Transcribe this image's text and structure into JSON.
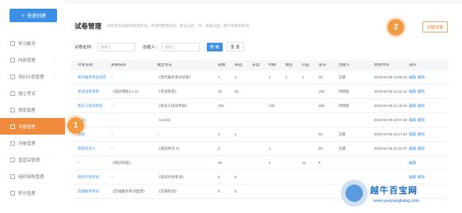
{
  "sidebar": {
    "quick_label": "快速创建",
    "items": [
      {
        "label": "学习概况",
        "caret": ""
      },
      {
        "label": "内容管理",
        "caret": "›"
      },
      {
        "label": "培训计划管理",
        "caret": "›"
      },
      {
        "label": "独立考试",
        "caret": ""
      },
      {
        "label": "题库管理",
        "caret": ""
      },
      {
        "label": "试卷管理",
        "caret": ""
      },
      {
        "label": "问卷管理",
        "caret": ""
      },
      {
        "label": "直营店管理",
        "caret": "›"
      },
      {
        "label": "组织架构管理",
        "caret": ""
      },
      {
        "label": "积分管理",
        "caret": ""
      }
    ]
  },
  "header": {
    "title": "试卷管理",
    "subtitle": "试卷包含试题的组合形式，考试时使用试卷，建议以初、中、高级分类，便于组卷和考试",
    "create_button": "创建试卷"
  },
  "filters": {
    "name_label": "试卷名称：",
    "name_placeholder": "请输入",
    "creator_label": "创建人：",
    "creator_placeholder": "请输入",
    "search_button": "搜 索",
    "reset_button": "重 置"
  },
  "table": {
    "headers": [
      "考卷名称",
      "关联培训",
      "独立考试",
      "题数",
      "单选",
      "多选",
      "判断",
      "填空",
      "问答",
      "总分",
      "创建人",
      "更新时间",
      "操作"
    ],
    "rows": [
      {
        "name": "现代服务考试试卷",
        "training": "--",
        "exam": "《现代服务考试试卷》",
        "q": "7",
        "s": "1",
        "m": "",
        "j": "1",
        "f": "1",
        "a": "1",
        "total": "30",
        "creator": "王静",
        "time": "2019-04-09 14:06:21",
        "ops": [
          "编辑",
          "删除"
        ]
      },
      {
        "name": "考试试卷卷卷",
        "training": "《培训课程4.1.1》",
        "exam": "《考试卷卷》",
        "q": "50",
        "s": "50",
        "m": "",
        "j": "",
        "f": "",
        "a": "",
        "total": "100",
        "creator": "孙晓丽",
        "time": "2019-04-09 11:22:44",
        "ops": [
          "编辑",
          "删除"
        ]
      },
      {
        "name": "新员工培训考核",
        "training": "--",
        "exam": "《新员工培训考核》",
        "q": "150",
        "s": "",
        "m": "",
        "j": "100",
        "f": "",
        "a": "",
        "total": "300",
        "creator": "孙晓丽",
        "time": "2019-04-09 11:18:20",
        "ops": [
          "编辑",
          "删除"
        ]
      },
      {
        "name": "ceshi",
        "training": "--",
        "exam": "《ceshi》",
        "q": "",
        "s": "",
        "m": "",
        "j": "",
        "f": "",
        "a": "",
        "total": "",
        "creator": "",
        "time": "2019-04-09 10:07:36",
        "ops": [
          "编辑",
          "删除"
        ]
      },
      {
        "name": "测试",
        "training": "--",
        "exam": "--",
        "q": "1",
        "s": "1",
        "m": "",
        "j": "",
        "f": "",
        "a": "",
        "total": "50",
        "creator": "王静",
        "time": "2019-04-08 15:17:24",
        "ops": [
          "编辑",
          "删除"
        ]
      },
      {
        "name": "测试考试 4",
        "training": "--",
        "exam": "《测试考试 4》",
        "q": "2",
        "s": "",
        "m": "",
        "j": "1",
        "f": "",
        "a": "",
        "total": "50",
        "creator": "王静",
        "time": "2019-04-08 11:04:37",
        "ops": [
          "编辑",
          "删除"
        ]
      },
      {
        "name": "--",
        "training": "《培训内容》",
        "exam": "",
        "q": "20",
        "s": "",
        "m": "",
        "j": "4",
        "f": "",
        "a": "12",
        "total": "6",
        "creator": "",
        "time": "",
        "ops": [
          "编辑"
        ]
      },
      {
        "name": "培训计划考试",
        "training": "--",
        "exam": "《培训计划考试》",
        "q": "5",
        "s": "5",
        "m": "",
        "j": "",
        "f": "",
        "a": "",
        "total": "",
        "creator": "",
        "time": "",
        "ops": [
          "编辑",
          "删除"
        ]
      },
      {
        "name": "店铺服务考试",
        "training": "《店铺服务考试直营》",
        "exam": "《店铺考试》",
        "q": "5",
        "s": "5",
        "m": "",
        "j": "",
        "f": "",
        "a": "",
        "total": "",
        "creator": "",
        "time": "",
        "ops": [
          "编辑"
        ]
      }
    ]
  },
  "badges": {
    "one": "1",
    "two": "2"
  },
  "watermark": {
    "brand": "越牛百宝网",
    "url": "www.yueyangbang.com"
  }
}
